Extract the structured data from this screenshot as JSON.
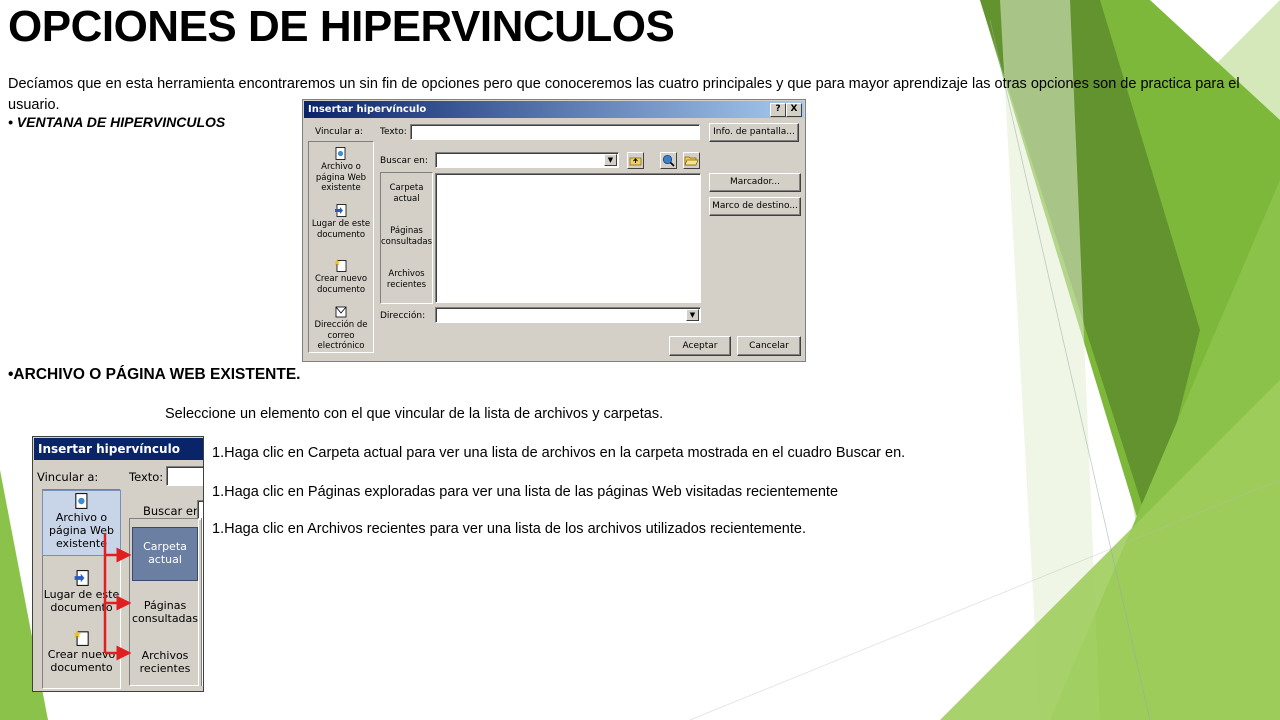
{
  "slide": {
    "title": "OPCIONES DE HIPERVINCULOS",
    "intro": "Decíamos que en esta herramienta encontraremos un sin fin de opciones pero que conoceremos las cuatro principales y que para mayor aprendizaje las otras opciones son de practica para el usuario.",
    "bullet_window": "• VENTANA DE HIPERVINCULOS",
    "section_heading": "•ARCHIVO O PÁGINA WEB EXISTENTE.",
    "lead": "Seleccione un elemento con el que vincular de la lista de archivos y carpetas.",
    "steps": [
      "1.Haga clic en Carpeta actual para ver una lista de archivos en la carpeta mostrada en el cuadro Buscar en.",
      "1.Haga clic en Páginas exploradas para ver una lista de las páginas Web visitadas recientemente",
      "1.Haga clic en Archivos recientes para ver una lista de los archivos utilizados recientemente."
    ],
    "colors": {
      "green_dark": "#5e8c2e",
      "green_mid": "#7db83a",
      "green_light": "#b9d98a",
      "green_pale": "#e2efcf",
      "arrow_red": "#e02020"
    }
  },
  "dialog": {
    "title": "Insertar hipervínculo",
    "help_btn": "?",
    "close_btn": "X",
    "vincular_label": "Vincular a:",
    "texto_label": "Texto:",
    "buscar_label": "Buscar en:",
    "direccion_label": "Dirección:",
    "nav": [
      {
        "label1": "Archivo o",
        "label2": "página Web",
        "label3": "existente",
        "icon": "web-page-icon"
      },
      {
        "label1": "Lugar de este",
        "label2": "documento",
        "label3": "",
        "icon": "place-document-icon"
      },
      {
        "label1": "Crear nuevo",
        "label2": "documento",
        "label3": "",
        "icon": "new-document-icon"
      },
      {
        "label1": "Dirección de",
        "label2": "correo",
        "label3": "electrónico",
        "icon": "email-icon"
      }
    ],
    "pane_items": [
      {
        "label1": "Carpeta",
        "label2": "actual"
      },
      {
        "label1": "Páginas",
        "label2": "consultadas"
      },
      {
        "label1": "Archivos",
        "label2": "recientes"
      }
    ],
    "btn_info": "Info. de pantalla...",
    "btn_marcador": "Marcador...",
    "btn_marco": "Marco de destino...",
    "btn_aceptar": "Aceptar",
    "btn_cancelar": "Cancelar"
  },
  "zoom_dialog": {
    "title": "Insertar hipervínculo",
    "vincular_label": "Vincular a:",
    "texto_label": "Texto:",
    "buscar_label": "Buscar en:",
    "nav": [
      {
        "label1": "Archivo o",
        "label2": "página Web",
        "label3": "existente"
      },
      {
        "label1": "Lugar de este",
        "label2": "documento"
      },
      {
        "label1": "Crear nuevo",
        "label2": "documento"
      }
    ],
    "pane_items": [
      {
        "label1": "Carpeta",
        "label2": "actual"
      },
      {
        "label1": "Páginas",
        "label2": "consultadas"
      },
      {
        "label1": "Archivos",
        "label2": "recientes"
      }
    ]
  }
}
